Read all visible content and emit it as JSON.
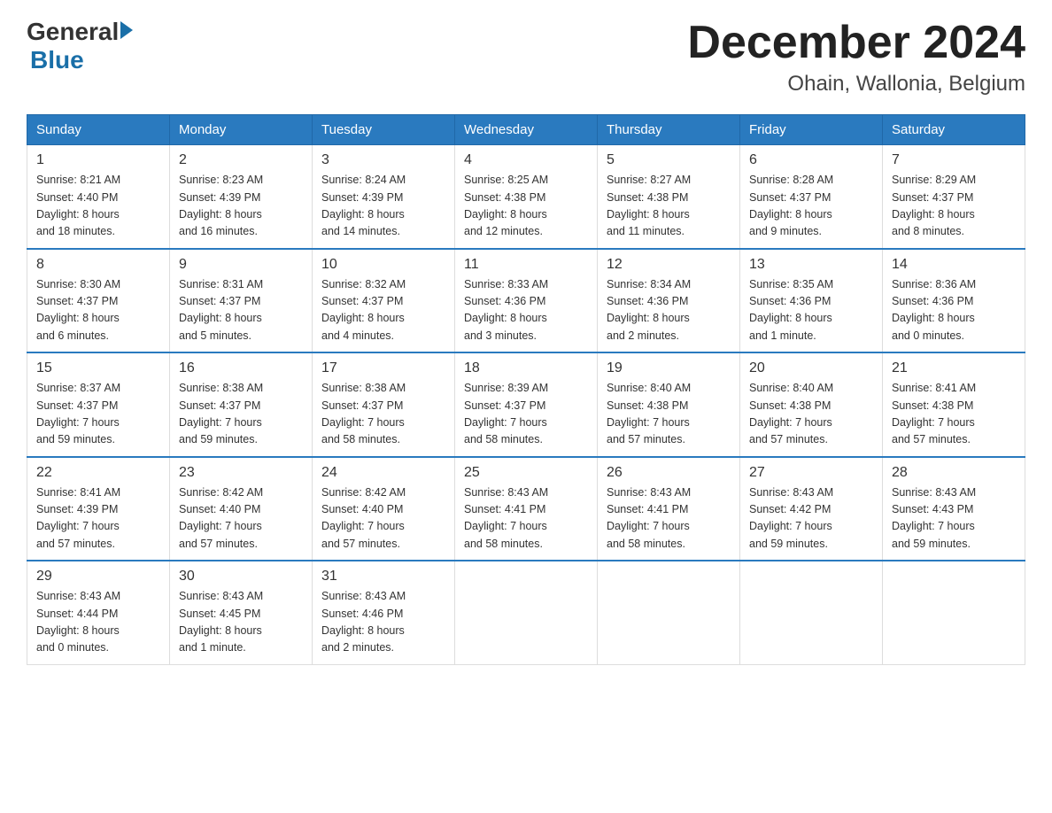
{
  "header": {
    "logo_general": "General",
    "logo_blue": "Blue",
    "month_title": "December 2024",
    "location": "Ohain, Wallonia, Belgium"
  },
  "days_of_week": [
    "Sunday",
    "Monday",
    "Tuesday",
    "Wednesday",
    "Thursday",
    "Friday",
    "Saturday"
  ],
  "weeks": [
    [
      {
        "day": "1",
        "sunrise": "8:21 AM",
        "sunset": "4:40 PM",
        "daylight": "8 hours and 18 minutes."
      },
      {
        "day": "2",
        "sunrise": "8:23 AM",
        "sunset": "4:39 PM",
        "daylight": "8 hours and 16 minutes."
      },
      {
        "day": "3",
        "sunrise": "8:24 AM",
        "sunset": "4:39 PM",
        "daylight": "8 hours and 14 minutes."
      },
      {
        "day": "4",
        "sunrise": "8:25 AM",
        "sunset": "4:38 PM",
        "daylight": "8 hours and 12 minutes."
      },
      {
        "day": "5",
        "sunrise": "8:27 AM",
        "sunset": "4:38 PM",
        "daylight": "8 hours and 11 minutes."
      },
      {
        "day": "6",
        "sunrise": "8:28 AM",
        "sunset": "4:37 PM",
        "daylight": "8 hours and 9 minutes."
      },
      {
        "day": "7",
        "sunrise": "8:29 AM",
        "sunset": "4:37 PM",
        "daylight": "8 hours and 8 minutes."
      }
    ],
    [
      {
        "day": "8",
        "sunrise": "8:30 AM",
        "sunset": "4:37 PM",
        "daylight": "8 hours and 6 minutes."
      },
      {
        "day": "9",
        "sunrise": "8:31 AM",
        "sunset": "4:37 PM",
        "daylight": "8 hours and 5 minutes."
      },
      {
        "day": "10",
        "sunrise": "8:32 AM",
        "sunset": "4:37 PM",
        "daylight": "8 hours and 4 minutes."
      },
      {
        "day": "11",
        "sunrise": "8:33 AM",
        "sunset": "4:36 PM",
        "daylight": "8 hours and 3 minutes."
      },
      {
        "day": "12",
        "sunrise": "8:34 AM",
        "sunset": "4:36 PM",
        "daylight": "8 hours and 2 minutes."
      },
      {
        "day": "13",
        "sunrise": "8:35 AM",
        "sunset": "4:36 PM",
        "daylight": "8 hours and 1 minute."
      },
      {
        "day": "14",
        "sunrise": "8:36 AM",
        "sunset": "4:36 PM",
        "daylight": "8 hours and 0 minutes."
      }
    ],
    [
      {
        "day": "15",
        "sunrise": "8:37 AM",
        "sunset": "4:37 PM",
        "daylight": "7 hours and 59 minutes."
      },
      {
        "day": "16",
        "sunrise": "8:38 AM",
        "sunset": "4:37 PM",
        "daylight": "7 hours and 59 minutes."
      },
      {
        "day": "17",
        "sunrise": "8:38 AM",
        "sunset": "4:37 PM",
        "daylight": "7 hours and 58 minutes."
      },
      {
        "day": "18",
        "sunrise": "8:39 AM",
        "sunset": "4:37 PM",
        "daylight": "7 hours and 58 minutes."
      },
      {
        "day": "19",
        "sunrise": "8:40 AM",
        "sunset": "4:38 PM",
        "daylight": "7 hours and 57 minutes."
      },
      {
        "day": "20",
        "sunrise": "8:40 AM",
        "sunset": "4:38 PM",
        "daylight": "7 hours and 57 minutes."
      },
      {
        "day": "21",
        "sunrise": "8:41 AM",
        "sunset": "4:38 PM",
        "daylight": "7 hours and 57 minutes."
      }
    ],
    [
      {
        "day": "22",
        "sunrise": "8:41 AM",
        "sunset": "4:39 PM",
        "daylight": "7 hours and 57 minutes."
      },
      {
        "day": "23",
        "sunrise": "8:42 AM",
        "sunset": "4:40 PM",
        "daylight": "7 hours and 57 minutes."
      },
      {
        "day": "24",
        "sunrise": "8:42 AM",
        "sunset": "4:40 PM",
        "daylight": "7 hours and 57 minutes."
      },
      {
        "day": "25",
        "sunrise": "8:43 AM",
        "sunset": "4:41 PM",
        "daylight": "7 hours and 58 minutes."
      },
      {
        "day": "26",
        "sunrise": "8:43 AM",
        "sunset": "4:41 PM",
        "daylight": "7 hours and 58 minutes."
      },
      {
        "day": "27",
        "sunrise": "8:43 AM",
        "sunset": "4:42 PM",
        "daylight": "7 hours and 59 minutes."
      },
      {
        "day": "28",
        "sunrise": "8:43 AM",
        "sunset": "4:43 PM",
        "daylight": "7 hours and 59 minutes."
      }
    ],
    [
      {
        "day": "29",
        "sunrise": "8:43 AM",
        "sunset": "4:44 PM",
        "daylight": "8 hours and 0 minutes."
      },
      {
        "day": "30",
        "sunrise": "8:43 AM",
        "sunset": "4:45 PM",
        "daylight": "8 hours and 1 minute."
      },
      {
        "day": "31",
        "sunrise": "8:43 AM",
        "sunset": "4:46 PM",
        "daylight": "8 hours and 2 minutes."
      },
      null,
      null,
      null,
      null
    ]
  ],
  "labels": {
    "sunrise": "Sunrise:",
    "sunset": "Sunset:",
    "daylight": "Daylight:"
  }
}
